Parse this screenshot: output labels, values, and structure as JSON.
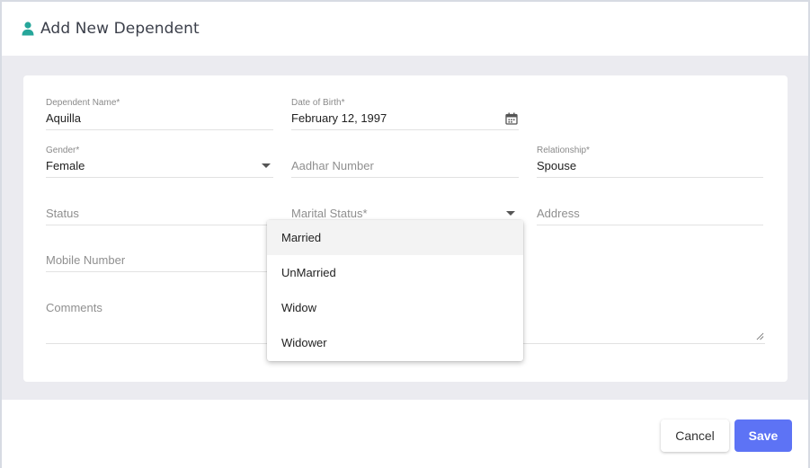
{
  "header": {
    "title": "Add New Dependent",
    "icon": "person-icon",
    "accent": "#26a69a"
  },
  "form": {
    "dependent_name": {
      "label": "Dependent Name*",
      "value": "Aquilla"
    },
    "date_of_birth": {
      "label": "Date of Birth*",
      "value": "February 12, 1997"
    },
    "gender": {
      "label": "Gender*",
      "value": "Female"
    },
    "aadhar": {
      "placeholder": "Aadhar Number"
    },
    "relationship": {
      "label": "Relationship*",
      "value": "Spouse"
    },
    "status": {
      "placeholder": "Status"
    },
    "marital_status": {
      "placeholder": "Marital Status*"
    },
    "address": {
      "placeholder": "Address"
    },
    "mobile": {
      "placeholder": "Mobile Number"
    },
    "comments": {
      "placeholder": "Comments"
    }
  },
  "marital_menu": {
    "options": [
      "Married",
      "UnMarried",
      "Widow",
      "Widower"
    ],
    "highlighted": "Married"
  },
  "footer": {
    "cancel_label": "Cancel",
    "save_label": "Save",
    "save_color": "#5d73f5"
  }
}
